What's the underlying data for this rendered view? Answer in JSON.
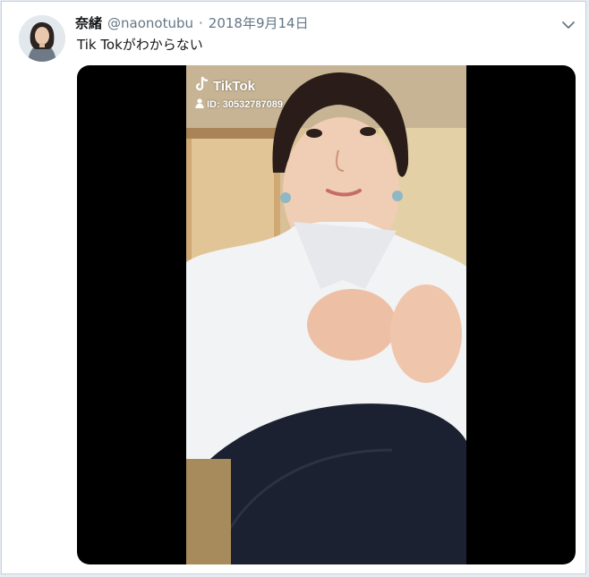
{
  "tweet": {
    "display_name": "奈緒",
    "handle": "@naonotubu",
    "separator": "·",
    "date": "2018年9月14日",
    "text": "Tik Tokがわからない"
  },
  "video": {
    "watermark_brand": "TikTok",
    "watermark_id": "ID: 30532787089"
  },
  "icons": {
    "menu": "chevron-down-icon",
    "brand": "tiktok-note-icon",
    "user": "user-icon"
  },
  "colors": {
    "name": "#14171a",
    "secondary": "#657786",
    "media_bg": "#000000"
  }
}
